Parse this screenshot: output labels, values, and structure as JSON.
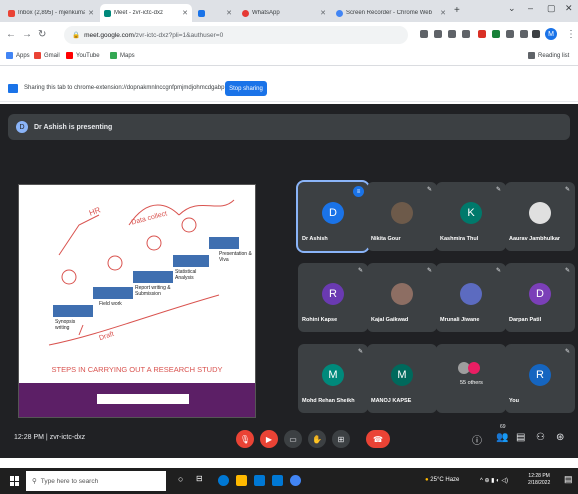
{
  "browser": {
    "tabs": [
      {
        "title": "Inbox (2,895) - mjenkumar@gn",
        "active": false
      },
      {
        "title": "Meet - zvr-ictc-dxz",
        "active": true
      },
      {
        "title": "",
        "active": false
      },
      {
        "title": "WhatsApp",
        "active": false
      },
      {
        "title": "Screen Recorder - Chrome Web",
        "active": false
      }
    ],
    "url_host": "meet.google.com",
    "url_path": "/zvr-ictc-dxz?pli=1&authuser=0",
    "profile_initial": "M",
    "bookmarks": [
      "Apps",
      "Gmail",
      "YouTube",
      "Maps"
    ],
    "reading_list": "Reading list"
  },
  "share_bar": {
    "text": "Sharing this tab to chrome-extension://dopnakmnlnccgnfpmjmdjohmcdgabp",
    "stop_label": "Stop sharing"
  },
  "meet": {
    "presenting_initial": "D",
    "presenting_text": "Dr Ashish is presenting",
    "slide": {
      "steps": [
        "Synopsis writing",
        "Field work",
        "Report writing & Submission",
        "Statistical Analysis",
        "Presentation & Viva"
      ],
      "handwriting": [
        "HR",
        "Data collect",
        "Draft"
      ],
      "title": "STEPS IN CARRYING OUT A RESEARCH STUDY"
    },
    "participants": [
      {
        "name": "Dr Ashish",
        "initial": "D",
        "color": "#1a73e8",
        "photo": false
      },
      {
        "name": "Nikita Gour",
        "initial": "",
        "color": "#5f6368",
        "photo": true
      },
      {
        "name": "Kashmira Thul",
        "initial": "K",
        "color": "#00796b",
        "photo": false
      },
      {
        "name": "Aaurav Jambhulkar",
        "initial": "",
        "color": "#5f6368",
        "photo": true
      },
      {
        "name": "Rohini Kapse",
        "initial": "R",
        "color": "#6a3ab2",
        "photo": false
      },
      {
        "name": "Kajal Gaikwad",
        "initial": "",
        "color": "#5f6368",
        "photo": true
      },
      {
        "name": "Mrunali Jiwane",
        "initial": "",
        "color": "#5f6368",
        "photo": true
      },
      {
        "name": "Darpan Patil",
        "initial": "D",
        "color": "#7b3fb8",
        "photo": false
      },
      {
        "name": "Mohd Rehan Sheikh",
        "initial": "M",
        "color": "#00897b",
        "photo": false
      },
      {
        "name": "MANOJ KAPSE",
        "initial": "M",
        "color": "#00695c",
        "photo": false
      },
      {
        "name": "55 others",
        "initial": "",
        "color": "#5f6368",
        "photo": false
      },
      {
        "name": "You",
        "initial": "R",
        "color": "#1565c0",
        "photo": false
      }
    ],
    "time": "12:28 PM",
    "separator": "|",
    "meeting_code": "zvr-ictc-dxz",
    "participant_count": "69"
  },
  "taskbar": {
    "search_placeholder": "Type here to search",
    "weather": "25°C Haze",
    "time": "12:28 PM",
    "date": "2/18/2022"
  }
}
